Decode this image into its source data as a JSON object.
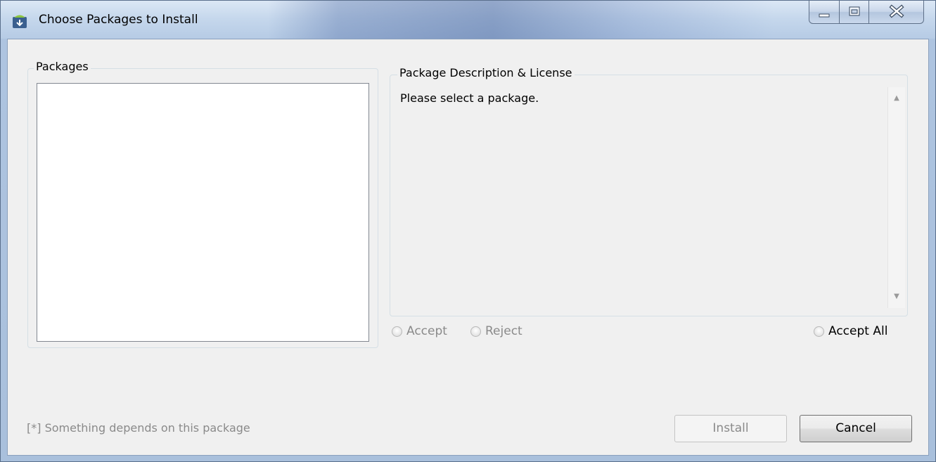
{
  "window": {
    "title": "Choose Packages to Install"
  },
  "icons": {
    "app": "android-download-icon",
    "minimize": "minimize-icon",
    "maximize": "maximize-icon",
    "close": "close-icon"
  },
  "packages_panel": {
    "legend": "Packages",
    "items": []
  },
  "description_panel": {
    "legend": "Package Description & License",
    "text": "Please select a package."
  },
  "license_options": {
    "accept": "Accept",
    "reject": "Reject",
    "accept_all": "Accept All"
  },
  "footer": {
    "note": "[*] Something depends on this package",
    "install_label": "Install",
    "cancel_label": "Cancel"
  }
}
